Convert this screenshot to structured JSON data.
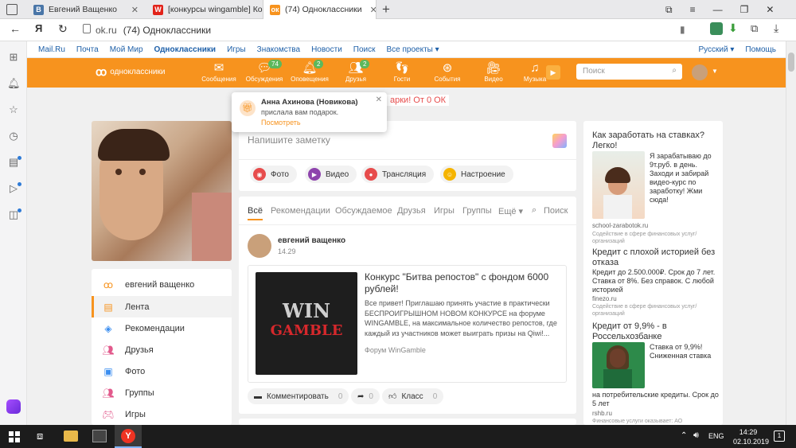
{
  "browser": {
    "tabs": [
      {
        "label": "Евгений Ващенко",
        "icon": "vk-icon"
      },
      {
        "label": "[конкурсы wingamble] Кон",
        "icon": "w-icon"
      },
      {
        "label": "(74) Одноклассники",
        "icon": "ok-icon"
      }
    ],
    "address_host": "ok.ru",
    "address_title": "(74) Одноклассники",
    "yandex_letter": "Я"
  },
  "portal_links": [
    "Mail.Ru",
    "Почта",
    "Мой Мир",
    "Одноклассники",
    "Игры",
    "Знакомства",
    "Новости",
    "Поиск",
    "Все проекты ▾"
  ],
  "portal_right": {
    "lang": "Русский ▾",
    "help": "Помощь"
  },
  "ok_nav": {
    "logo": "одноклассники",
    "items": [
      {
        "label": "Сообщения",
        "badge": ""
      },
      {
        "label": "Обсуждения",
        "badge": "74"
      },
      {
        "label": "Оповещения",
        "badge": "2"
      },
      {
        "label": "Друзья",
        "badge": "2"
      },
      {
        "label": "Гости",
        "badge": ""
      },
      {
        "label": "События",
        "badge": ""
      },
      {
        "label": "Видео",
        "badge": ""
      },
      {
        "label": "Музыка",
        "badge": ""
      }
    ],
    "search_placeholder": "Поиск"
  },
  "notification": {
    "name": "Анна Ахинова (Новикова)",
    "text": "прислала вам подарок.",
    "link": "Посмотреть",
    "behind": "арки! От 0 ОК"
  },
  "left_menu": [
    "евгений ващенко",
    "Лента",
    "Рекомендации",
    "Друзья",
    "Фото",
    "Группы",
    "Игры"
  ],
  "post_box": {
    "placeholder": "Напишите заметку",
    "buttons": [
      "Фото",
      "Видео",
      "Трансляция",
      "Настроение"
    ]
  },
  "feed_tabs": [
    "Всё",
    "Рекомендации",
    "Обсуждаемое",
    "Друзья",
    "Игры",
    "Группы",
    "Ещё ▾",
    "Поиск"
  ],
  "post": {
    "author": "евгений ващенко",
    "time": "14.29",
    "title": "Конкурс \"Битва репостов\" с фондом 6000 рублей!",
    "excerpt": "Все привет! Приглашаю принять участие в практически БЕСПРОИГРЫШНОМ НОВОМ КОНКУРСЕ на форуме WINGAMBLE, на максимальное количество репостов, где каждый из участников может выиграть призы на Qiwi!...",
    "source": "Форум WinGamble",
    "image_line1": "WIN",
    "image_line2": "GAMBLE",
    "comment_label": "Комментировать",
    "comment_count": "0",
    "share_count": "0",
    "like_label": "Класс",
    "like_count": "0"
  },
  "ads": [
    {
      "title": "Как заработать на ставках? Легко!",
      "text": "Я зарабатываю до 9т.руб. в день. Заходи и забирай видео-курс по заработку! Жми сюда!",
      "source": "school-zarabotok.ru",
      "disclaimer": "Содействие в сфере финансовых услуг/организаций"
    },
    {
      "title": "Кредит с плохой историей без отказа",
      "text": "Кредит до 2.500.000₽. Срок до 7 лет. Ставка от 8%. Без справок. С любой историей",
      "source": "finezo.ru",
      "disclaimer": "Содействие в сфере финансовых услуг/организаций"
    },
    {
      "title": "Кредит от 9,9% - в Россельхозбанке",
      "text": "Ставка от 9,9%! Сниженная ставка",
      "text2": "на потребительские кредиты. Срок до 5 лет",
      "source": "rshb.ru",
      "disclaimer": "Финансовые услуги оказывает: АО"
    }
  ],
  "taskbar": {
    "lang": "ENG",
    "time": "14:29",
    "date": "02.10.2019",
    "notif_count": "1"
  }
}
